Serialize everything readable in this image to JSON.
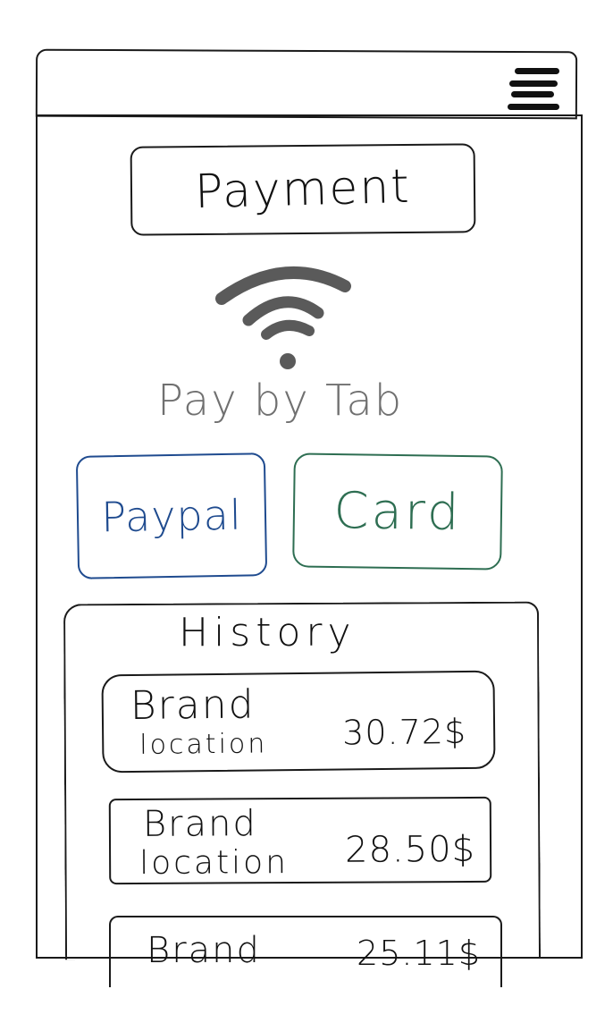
{
  "header": {
    "menu_icon": "hamburger-icon"
  },
  "page": {
    "title": "Payment"
  },
  "tap_to_pay": {
    "icon": "contactless-wifi-icon",
    "label": "Pay by Tab",
    "icon_color": "#5a5a5a",
    "label_color": "#707070"
  },
  "payment_methods": {
    "paypal_label": "Paypal",
    "paypal_color": "#1f4b8f",
    "card_label": "Card",
    "card_color": "#2e6e52"
  },
  "history": {
    "title": "History",
    "items": [
      {
        "brand": "Brand",
        "location": "location",
        "amount": "30.72$"
      },
      {
        "brand": "Brand",
        "location": "location",
        "amount": "28.50$"
      },
      {
        "brand": "Brand",
        "location": "",
        "amount": "25.11$"
      }
    ]
  }
}
